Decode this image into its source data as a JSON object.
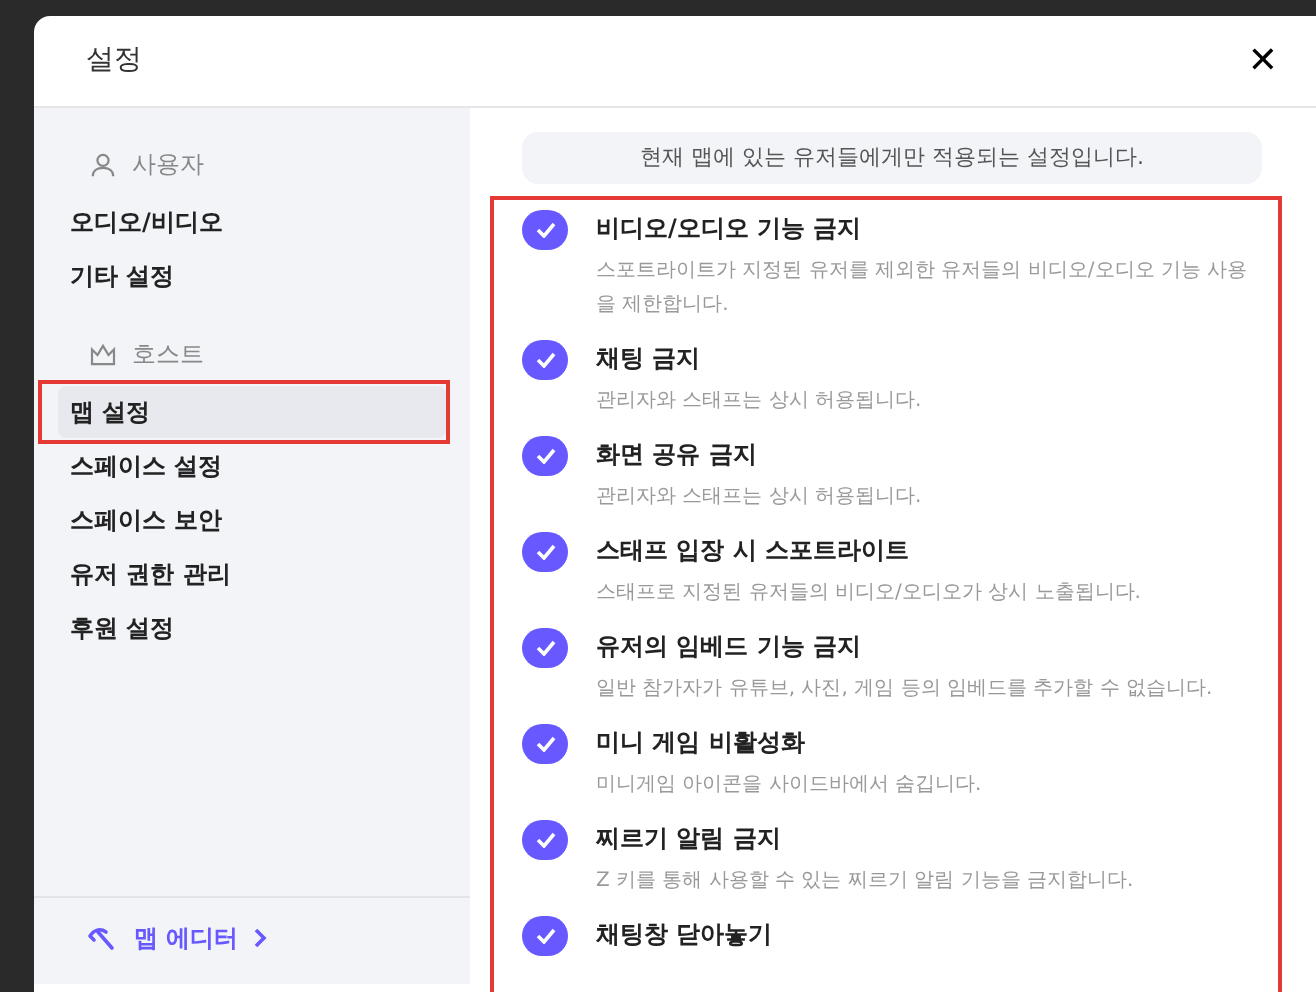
{
  "dialog": {
    "title": "설정",
    "close": "✕"
  },
  "sidebar": {
    "sections": [
      {
        "kind": "user",
        "label": "사용자",
        "items": [
          {
            "label": "오디오/비디오",
            "selected": false
          },
          {
            "label": "기타 설정",
            "selected": false
          }
        ]
      },
      {
        "kind": "host",
        "label": "호스트",
        "items": [
          {
            "label": "맵 설정",
            "selected": true
          },
          {
            "label": "스페이스 설정",
            "selected": false
          },
          {
            "label": "스페이스 보안",
            "selected": false
          },
          {
            "label": "유저 권한 관리",
            "selected": false
          },
          {
            "label": "후원 설정",
            "selected": false
          }
        ]
      }
    ],
    "footer_link": "맵 에디터"
  },
  "notice": "현재 맵에 있는 유저들에게만 적용되는 설정입니다.",
  "options": [
    {
      "title": "비디오/오디오 기능 금지",
      "description": "스포트라이트가 지정된 유저를 제외한 유저들의 비디오/오디오 기능 사용을 제한합니다.",
      "checked": true
    },
    {
      "title": "채팅 금지",
      "description": "관리자와 스태프는 상시 허용됩니다.",
      "checked": true
    },
    {
      "title": "화면 공유 금지",
      "description": "관리자와 스태프는 상시 허용됩니다.",
      "checked": true
    },
    {
      "title": "스태프 입장 시 스포트라이트",
      "description": "스태프로 지정된 유저들의 비디오/오디오가 상시 노출됩니다.",
      "checked": true
    },
    {
      "title": "유저의 임베드 기능 금지",
      "description": "일반 참가자가 유튜브, 사진, 게임 등의 임베드를 추가할 수 없습니다.",
      "checked": true
    },
    {
      "title": "미니 게임 비활성화",
      "description": "미니게임 아이콘을 사이드바에서 숨깁니다.",
      "checked": true
    },
    {
      "title": "찌르기 알림 금지",
      "description": "Z 키를 통해 사용할 수 있는 찌르기 알림 기능을 금지합니다.",
      "checked": true
    },
    {
      "title": "채팅창 닫아놓기",
      "checked": true
    }
  ]
}
